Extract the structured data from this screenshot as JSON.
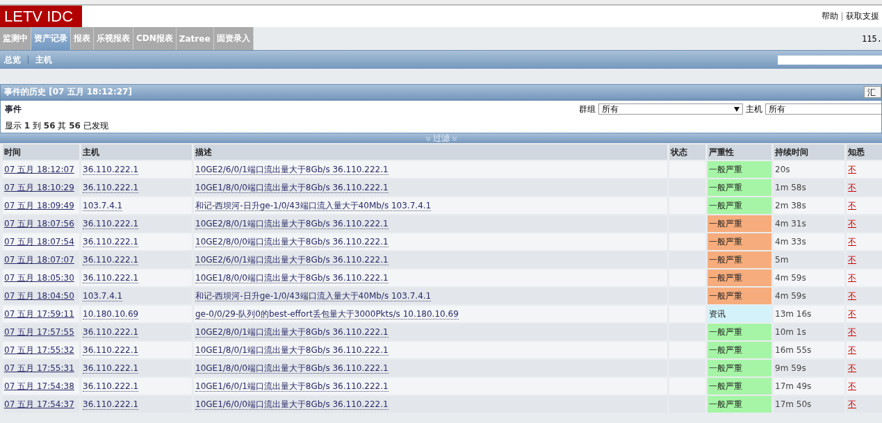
{
  "logo": "LETV IDC",
  "top_links": [
    {
      "label": "帮助"
    },
    {
      "label": "获取支援"
    }
  ],
  "main_tabs": [
    {
      "label": "监测中",
      "selected": false
    },
    {
      "label": "资产记录",
      "selected": true
    },
    {
      "label": "报表",
      "selected": false
    },
    {
      "label": "乐视报表",
      "selected": false
    },
    {
      "label": "CDN报表",
      "selected": false
    },
    {
      "label": "Zatree",
      "selected": false
    },
    {
      "label": "固资录入",
      "selected": false
    }
  ],
  "server_text": "115.",
  "sub_tabs": [
    {
      "label": "总览"
    },
    {
      "label": "主机"
    }
  ],
  "panel": {
    "title": "事件的历史 [07 五月 18:12:27]",
    "export_button": "汇"
  },
  "filter": {
    "heading": "事件",
    "group_label": "群组",
    "group_value": "所有",
    "host_label": "主机",
    "host_value": "所有",
    "summary": "显示 **1** 到 **56** 其 **56** 已发现",
    "toggle": "过滤"
  },
  "table": {
    "columns": [
      "时间",
      "主机",
      "描述",
      "状态",
      "严重性",
      "持续时间",
      "知悉"
    ],
    "rows": [
      {
        "time": "07 五月 18:12:07",
        "host": "36.110.222.1",
        "description": "10GE2/6/0/1端口流出量大于8Gb/s 36.110.222.1",
        "severity": "一般严重",
        "color": "#a6f5a6",
        "duration": "20s",
        "ack": "不"
      },
      {
        "time": "07 五月 18:10:29",
        "host": "36.110.222.1",
        "description": "10GE1/8/0/0端口流出量大于8Gb/s 36.110.222.1",
        "severity": "一般严重",
        "color": "#a6f5a6",
        "duration": "1m 58s",
        "ack": "不"
      },
      {
        "time": "07 五月 18:09:49",
        "host": "103.7.4.1",
        "description": "和记-西坝河-日升ge-1/0/43端口流入量大于40Mb/s 103.7.4.1",
        "severity": "一般严重",
        "color": "#a6f5a6",
        "duration": "2m 38s",
        "ack": "不"
      },
      {
        "time": "07 五月 18:07:56",
        "host": "36.110.222.1",
        "description": "10GE2/8/0/1端口流出量大于8Gb/s 36.110.222.1",
        "severity": "一般严重",
        "color": "#f6ac7c",
        "duration": "4m 31s",
        "ack": "不"
      },
      {
        "time": "07 五月 18:07:54",
        "host": "36.110.222.1",
        "description": "10GE2/8/0/0端口流出量大于8Gb/s 36.110.222.1",
        "severity": "一般严重",
        "color": "#f6ac7c",
        "duration": "4m 33s",
        "ack": "不"
      },
      {
        "time": "07 五月 18:07:07",
        "host": "36.110.222.1",
        "description": "10GE2/6/0/1端口流出量大于8Gb/s 36.110.222.1",
        "severity": "一般严重",
        "color": "#f6ac7c",
        "duration": "5m",
        "ack": "不"
      },
      {
        "time": "07 五月 18:05:30",
        "host": "36.110.222.1",
        "description": "10GE1/8/0/0端口流出量大于8Gb/s 36.110.222.1",
        "severity": "一般严重",
        "color": "#f6ac7c",
        "duration": "4m 59s",
        "ack": "不"
      },
      {
        "time": "07 五月 18:04:50",
        "host": "103.7.4.1",
        "description": "和记-西坝河-日升ge-1/0/43端口流入量大于40Mb/s 103.7.4.1",
        "severity": "一般严重",
        "color": "#f6ac7c",
        "duration": "4m 59s",
        "ack": "不"
      },
      {
        "time": "07 五月 17:59:11",
        "host": "10.180.10.69",
        "description": "ge-0/0/29-队列0的best-effort丢包量大于3000Pkts/s 10.180.10.69",
        "severity": "资讯",
        "color": "#d4f2fa",
        "duration": "13m 16s",
        "ack": "不"
      },
      {
        "time": "07 五月 17:57:55",
        "host": "36.110.222.1",
        "description": "10GE2/8/0/1端口流出量大于8Gb/s 36.110.222.1",
        "severity": "一般严重",
        "color": "#a6f5a6",
        "duration": "10m 1s",
        "ack": "不"
      },
      {
        "time": "07 五月 17:55:32",
        "host": "36.110.222.1",
        "description": "10GE1/8/0/1端口流出量大于8Gb/s 36.110.222.1",
        "severity": "一般严重",
        "color": "#a6f5a6",
        "duration": "16m 55s",
        "ack": "不"
      },
      {
        "time": "07 五月 17:55:31",
        "host": "36.110.222.1",
        "description": "10GE1/8/0/0端口流出量大于8Gb/s 36.110.222.1",
        "severity": "一般严重",
        "color": "#a6f5a6",
        "duration": "9m 59s",
        "ack": "不"
      },
      {
        "time": "07 五月 17:54:38",
        "host": "36.110.222.1",
        "description": "10GE1/6/0/1端口流出量大于8Gb/s 36.110.222.1",
        "severity": "一般严重",
        "color": "#a6f5a6",
        "duration": "17m 49s",
        "ack": "不"
      },
      {
        "time": "07 五月 17:54:37",
        "host": "36.110.222.1",
        "description": "10GE1/6/0/0端口流出量大于8Gb/s 36.110.222.1",
        "severity": "一般严重",
        "color": "#a6f5a6",
        "duration": "17m 50s",
        "ack": "不"
      }
    ]
  }
}
